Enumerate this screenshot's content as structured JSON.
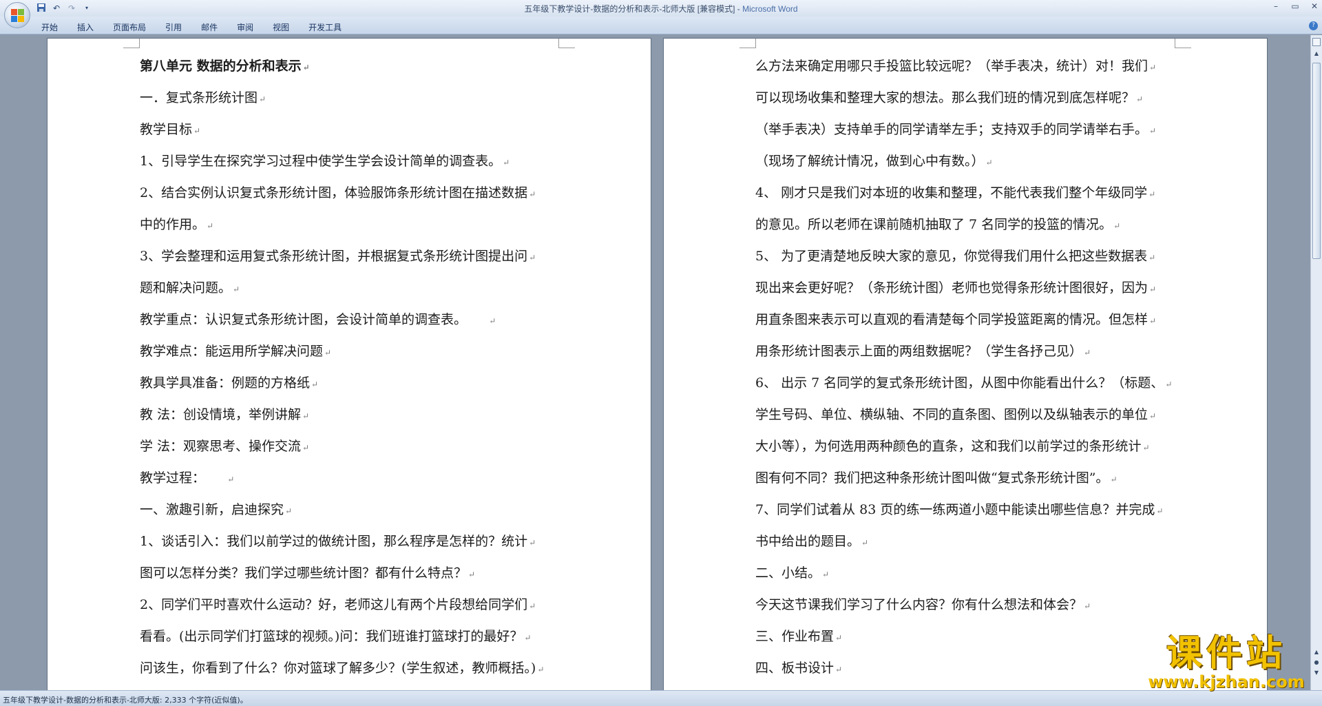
{
  "window": {
    "title_doc": "五年级下教学设计-数据的分析和表示-北师大版 [兼容模式]",
    "title_sep": " - ",
    "title_app": "Microsoft Word"
  },
  "ribbon": {
    "tabs": [
      "开始",
      "插入",
      "页面布局",
      "引用",
      "邮件",
      "审阅",
      "视图",
      "开发工具"
    ]
  },
  "document": {
    "page1_lines": [
      {
        "text": "第八单元 数据的分析和表示",
        "bold": true
      },
      {
        "text": "一．复式条形统计图"
      },
      {
        "text": "教学目标"
      },
      {
        "text": "1、引导学生在探究学习过程中使学生学会设计简单的调查表。"
      },
      {
        "text": "2、结合实例认识复式条形统计图，体验服饰条形统计图在描述数据"
      },
      {
        "text": "中的作用。"
      },
      {
        "text": "3、学会整理和运用复式条形统计图，并根据复式条形统计图提出问"
      },
      {
        "text": "题和解决问题。"
      },
      {
        "text": "教学重点：认识复式条形统计图，会设计简单的调查表。     "
      },
      {
        "text": "教学难点：能运用所学解决问题"
      },
      {
        "text": "教具学具准备：例题的方格纸"
      },
      {
        "text": "教 法：创设情境，举例讲解"
      },
      {
        "text": "学 法：观察思考、操作交流"
      },
      {
        "text": "教学过程：     "
      },
      {
        "text": "一、激趣引新，启迪探究"
      },
      {
        "text": "1、谈话引入：我们以前学过的做统计图，那么程序是怎样的？统计"
      },
      {
        "text": "图可以怎样分类？我们学过哪些统计图？都有什么特点？"
      },
      {
        "text": "2、同学们平时喜欢什么运动？好，老师这儿有两个片段想给同学们"
      },
      {
        "text": "看看。(出示同学们打篮球的视频。)问：我们班谁打篮球打的最好？"
      },
      {
        "text": "问该生，你看到了什么？你对篮球了解多少？(学生叙述，教师概括。)"
      }
    ],
    "page2_lines": [
      {
        "text": "么方法来确定用哪只手投篮比较远呢？（举手表决，统计）对！我们"
      },
      {
        "text": "可以现场收集和整理大家的想法。那么我们班的情况到底怎样呢？"
      },
      {
        "text": "（举手表决）支持单手的同学请举左手；支持双手的同学请举右手。"
      },
      {
        "text": "（现场了解统计情况，做到心中有数。）"
      },
      {
        "text": "4、 刚才只是我们对本班的收集和整理，不能代表我们整个年级同学"
      },
      {
        "text": "的意见。所以老师在课前随机抽取了 7 名同学的投篮的情况。"
      },
      {
        "text": "5、 为了更清楚地反映大家的意见，你觉得我们用什么把这些数据表"
      },
      {
        "text": "现出来会更好呢？（条形统计图）老师也觉得条形统计图很好，因为"
      },
      {
        "text": "用直条图来表示可以直观的看清楚每个同学投篮距离的情况。但怎样"
      },
      {
        "text": "用条形统计图表示上面的两组数据呢？（学生各抒己见）"
      },
      {
        "text": "6、 出示 7 名同学的复式条形统计图，从图中你能看出什么？（标题、"
      },
      {
        "text": "学生号码、单位、横纵轴、不同的直条图、图例以及纵轴表示的单位"
      },
      {
        "text": "大小等），为何选用两种颜色的直条，这和我们以前学过的条形统计"
      },
      {
        "text": "图有何不同？我们把这种条形统计图叫做“复式条形统计图”。"
      },
      {
        "text": "7、同学们试着从 83 页的练一练两道小题中能读出哪些信息？并完成"
      },
      {
        "text": "书中给出的题目。"
      },
      {
        "text": "二、小结。"
      },
      {
        "text": "今天这节课我们学习了什么内容？你有什么想法和体会？"
      },
      {
        "text": "三、作业布置"
      },
      {
        "text": "四、板书设计"
      }
    ],
    "paragraph_mark": "↵"
  },
  "statusbar": {
    "text": "五年级下教学设计-数据的分析和表示-北师大版: 2,333 个字符(近似值)。"
  },
  "watermark": {
    "title": "课件站",
    "url": "www.kjzhan.com"
  },
  "icons": {
    "office_button": "office-logo-icon",
    "save": "save-icon",
    "undo": "undo-icon",
    "redo": "redo-icon",
    "customize": "dropdown-icon",
    "minimize": "minimize-icon",
    "maximize": "maximize-icon",
    "close": "close-icon",
    "help": "help-icon"
  },
  "colors": {
    "workspace": "#8c9aac",
    "watermark_yellow": "#f2c200"
  }
}
